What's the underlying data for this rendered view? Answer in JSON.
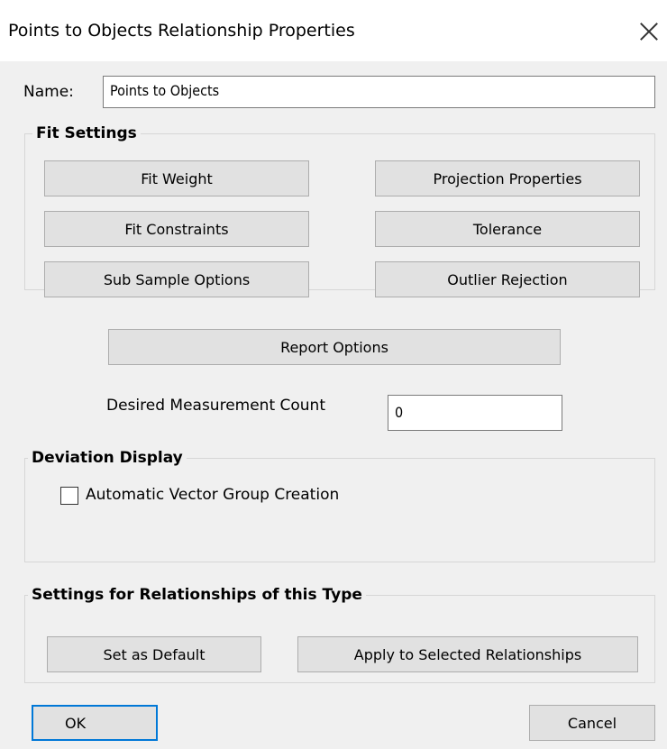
{
  "window": {
    "title": "Points to Objects Relationship Properties"
  },
  "name_field": {
    "label": "Name:",
    "value": "Points to Objects"
  },
  "fit_settings": {
    "title": "Fit Settings",
    "fit_weight": "Fit Weight",
    "projection_properties": "Projection Properties",
    "fit_constraints": "Fit Constraints",
    "tolerance": "Tolerance",
    "sub_sample_options": "Sub Sample Options",
    "outlier_rejection": "Outlier Rejection"
  },
  "report_options": "Report Options",
  "measurement": {
    "label": "Desired Measurement Count",
    "value": "0"
  },
  "deviation_display": {
    "title": "Deviation Display",
    "checkbox_label": "Automatic Vector Group Creation",
    "checked": false
  },
  "relationship_settings": {
    "title": "Settings for Relationships of this Type",
    "set_default": "Set as Default",
    "apply_selected": "Apply to Selected Relationships"
  },
  "footer": {
    "ok": "OK",
    "cancel": "Cancel"
  },
  "colors": {
    "background": "#f0f0f0",
    "button_face": "#e1e1e1",
    "button_border": "#adadad",
    "default_button_border": "#0078d7"
  }
}
